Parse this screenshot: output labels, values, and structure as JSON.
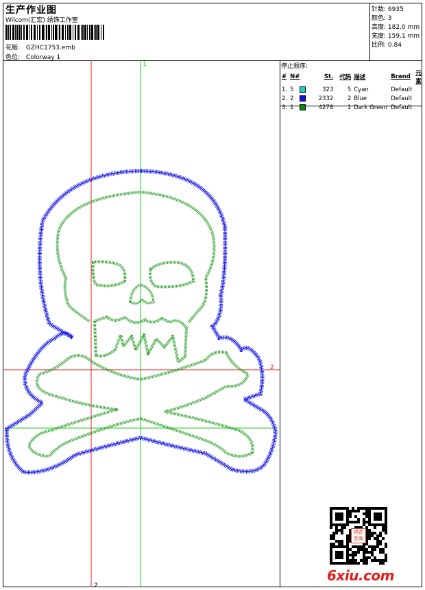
{
  "header": {
    "title": "生产作业图",
    "company": "Wilcom(汇宏) 绣饰工作室",
    "design_label": "花版:",
    "design_value": "GZHC1753.emb",
    "color_label": "色位:",
    "color_value": "Colorway 1"
  },
  "stats": [
    {
      "label": "针数:",
      "value": "6935"
    },
    {
      "label": "颜色:",
      "value": "3"
    },
    {
      "label": "高度:",
      "value": "182.0 mm"
    },
    {
      "label": "宽度:",
      "value": "159.1 mm"
    },
    {
      "label": "比例:",
      "value": "0.84"
    }
  ],
  "sequence": {
    "title": "停止顺序:",
    "headers": [
      "#",
      "N#",
      "St.",
      "代码",
      "描述",
      "Brand",
      "元素"
    ],
    "rows": [
      {
        "index": "1.",
        "n": "5",
        "color": "#19d3d3",
        "stitches": "323",
        "code": "5",
        "desc": "Cyan",
        "brand": "Default"
      },
      {
        "index": "2.",
        "n": "2",
        "color": "#0a14e6",
        "stitches": "2332",
        "code": "2",
        "desc": "Blue",
        "brand": "Default"
      },
      {
        "index": "3.",
        "n": "1",
        "color": "#0a8a14",
        "stitches": "4278",
        "code": "1",
        "desc": "Dark Green",
        "brand": "Default"
      }
    ]
  },
  "axes": {
    "green_top_label": "1",
    "red_right_label": "2",
    "red_bottom_label": "2"
  },
  "colors": {
    "outline_blue": "#1a1ae6",
    "inner_green": "#1e9a1e",
    "axis_red": "#e02020",
    "axis_green": "#18d018"
  },
  "seal_text": "绣花图库",
  "watermark": "6xiu.com"
}
